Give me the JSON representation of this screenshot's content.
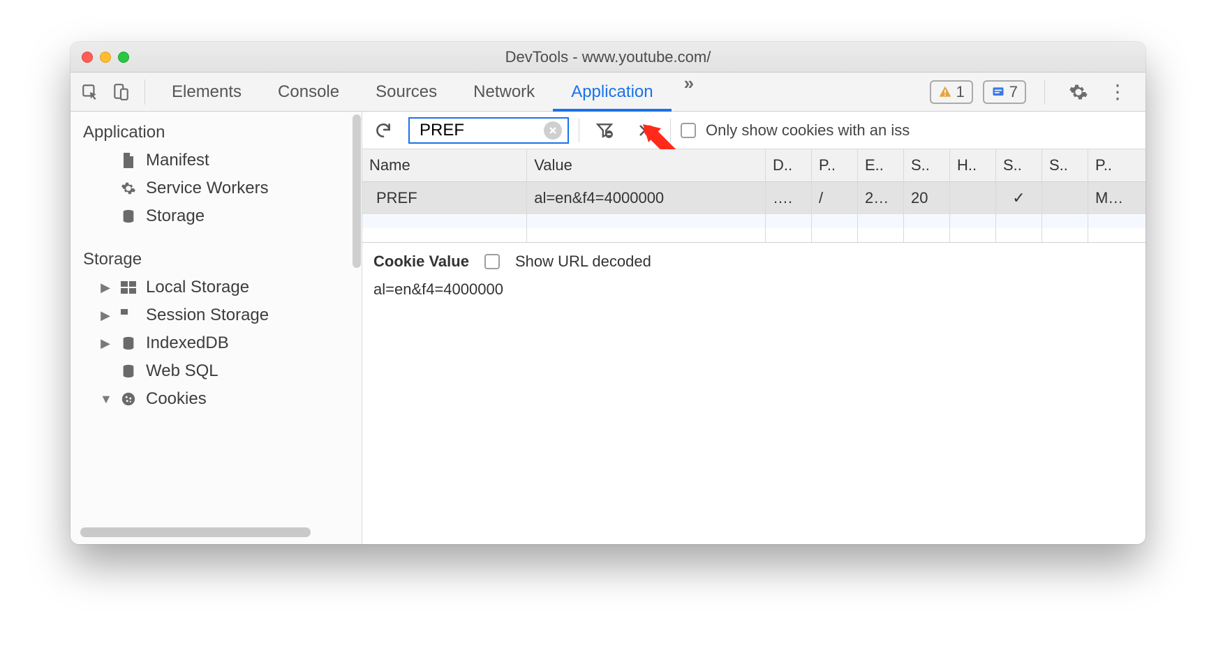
{
  "window": {
    "title": "DevTools - www.youtube.com/"
  },
  "toolbar": {
    "tabs": [
      "Elements",
      "Console",
      "Sources",
      "Network",
      "Application"
    ],
    "active_tab": "Application",
    "warning_count": "1",
    "info_count": "7",
    "more": "»"
  },
  "sidebar": {
    "sections": [
      {
        "title": "Application",
        "items": [
          {
            "label": "Manifest",
            "icon": "file"
          },
          {
            "label": "Service Workers",
            "icon": "gear"
          },
          {
            "label": "Storage",
            "icon": "db"
          }
        ]
      },
      {
        "title": "Storage",
        "items": [
          {
            "label": "Local Storage",
            "icon": "grid",
            "twisty": "▶"
          },
          {
            "label": "Session Storage",
            "icon": "grid",
            "twisty": "▶"
          },
          {
            "label": "IndexedDB",
            "icon": "db",
            "twisty": "▶"
          },
          {
            "label": "Web SQL",
            "icon": "db",
            "twisty": ""
          },
          {
            "label": "Cookies",
            "icon": "cookie",
            "twisty": "▼"
          }
        ]
      }
    ]
  },
  "filterbar": {
    "input_value": "PREF",
    "only_issues_label": "Only show cookies with an iss"
  },
  "cookies_table": {
    "columns": [
      "Name",
      "Value",
      "D..",
      "P..",
      "E..",
      "S..",
      "H..",
      "S..",
      "S..",
      "P.."
    ],
    "rows": [
      {
        "name": "PREF",
        "value": "al=en&f4=4000000",
        "d": "….",
        "p": "/",
        "e": "2…",
        "s": "20",
        "h": "",
        "sec": "✓",
        "ss": "",
        "pr": "M…"
      }
    ]
  },
  "detail": {
    "heading": "Cookie Value",
    "decode_label": "Show URL decoded",
    "value": "al=en&f4=4000000"
  }
}
